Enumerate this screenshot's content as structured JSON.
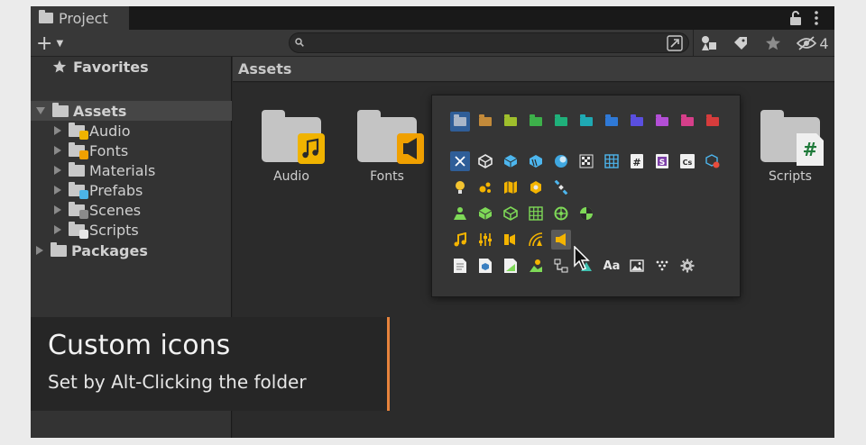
{
  "window": {
    "tab_title": "Project"
  },
  "toolbar": {
    "search_placeholder": "",
    "hidden_count": "4"
  },
  "sidebar": {
    "favorites": "Favorites",
    "assets": "Assets",
    "children": [
      "Audio",
      "Fonts",
      "Materials",
      "Prefabs",
      "Scenes",
      "Scripts"
    ],
    "packages": "Packages"
  },
  "assets_panel": {
    "header": "Assets",
    "items": [
      "Audio",
      "Fonts",
      "Scripts"
    ]
  },
  "picker": {
    "folder_colors": [
      "#a9b6c8",
      "#c38a3a",
      "#9fbf2c",
      "#3db04a",
      "#1fb07a",
      "#1fa9b3",
      "#2f79d6",
      "#5a4fe0",
      "#b34fd6",
      "#d63f8a",
      "#d63c3c"
    ],
    "row2_text_icons": {
      "hash": "#",
      "cs": "Cs"
    },
    "row6_font_label": "Aa"
  },
  "caption": {
    "title": "Custom icons",
    "subtitle": "Set by Alt-Clicking the folder",
    "accent": "#e7833c"
  }
}
